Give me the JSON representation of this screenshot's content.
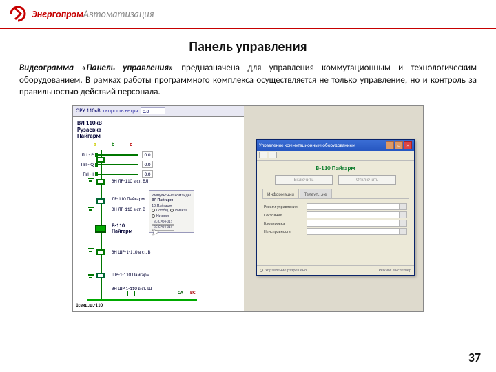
{
  "brand": {
    "part1": "Энергопром",
    "part2": "Автоматизация"
  },
  "title": "Панель управления",
  "desc": {
    "em": "Видеограмма «Панель управления»",
    "rest": " предназначена для управления коммутационным и технологическим оборудованием. В рамках работы программного комплекса осуществляется не только управление, но и контроль за правильностью действий персонала."
  },
  "scada": {
    "topbar": {
      "label": "ОРУ 110кВ",
      "hint": "скорость ветра",
      "value": "0.0"
    },
    "vl_caption_l1": "ВЛ 110кВ",
    "vl_caption_l2": "Рузаевка-",
    "vl_caption_l3": "Пайгарм",
    "phases": {
      "a": "a",
      "b": "b",
      "c": "c"
    },
    "rows": [
      {
        "label": "ПгI - P",
        "v": "0.0"
      },
      {
        "label": "ПгI - Q",
        "v": "0.0"
      },
      {
        "label": "ПгI - I",
        "v": "0.0"
      }
    ],
    "labels": {
      "nl1": "ЗН ЛР-110 в ст. ВЛ",
      "nl2": "ЛР-110 Пайгарм",
      "nl3": "ЗН ЛР-110 в ст. В",
      "nl4a": "В-110",
      "nl4b": "Пайгарм",
      "nl5": "ЗН ШР-1-110 в ст. В",
      "nl6": "ШР-1-110 Пайгарм",
      "nl7": "ЗН ШР 1-110 в ст. Ш",
      "bb": "1секц.ш.-110",
      "bb_tag": "CA",
      "bb_tag2": "BC"
    },
    "info_popup": {
      "h": "Импульсные команды",
      "r1": "ВЛ Пайгарм",
      "r2": "10.Пайгарм",
      "o1": "Сообщ.",
      "o2": "Низкая",
      "o3": "Низкая",
      "t1": "ВС-СРО4-011",
      "t2": "ВС-СРО4-011"
    }
  },
  "win": {
    "title": "Управление коммутационным оборудованием",
    "device": "В-110 Пайгарм",
    "btn_on": "Включить",
    "btn_off": "Отключить",
    "tabs": [
      "Информация",
      "Телеуп...ие"
    ],
    "fields": [
      "Режим управления",
      "Состояние",
      "Блокировка",
      "Неисправность"
    ],
    "status_left": "Управление разрешено",
    "status_right": "Режим: Диспетчер"
  },
  "page_num": "37"
}
